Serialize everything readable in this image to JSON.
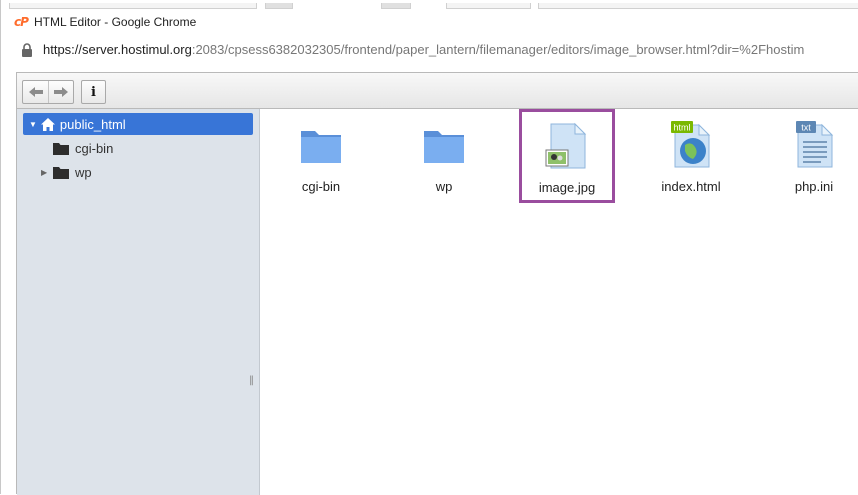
{
  "window": {
    "title": "HTML Editor - Google Chrome",
    "logo_text": "cP",
    "url_host": "https://server.hostimul.org",
    "url_rest": ":2083/cpsess6382032305/frontend/paper_lantern/filemanager/editors/image_browser.html?dir=%2Fhostim"
  },
  "toolbar": {
    "back_icon": "arrow-left-icon",
    "forward_icon": "arrow-right-icon",
    "info_label": "i"
  },
  "tree": {
    "root": {
      "label": "public_html",
      "icon": "home-icon"
    },
    "children": [
      {
        "label": "cgi-bin",
        "expandable": false
      },
      {
        "label": "wp",
        "expandable": true
      }
    ]
  },
  "files": [
    {
      "name": "cgi-bin",
      "type": "folder"
    },
    {
      "name": "wp",
      "type": "folder"
    },
    {
      "name": "image.jpg",
      "type": "image",
      "selected": true
    },
    {
      "name": "index.html",
      "type": "html",
      "badge": "html"
    },
    {
      "name": "php.ini",
      "type": "text",
      "badge": "txt"
    }
  ],
  "colors": {
    "selection": "#3875d7",
    "highlight_box": "#9a4d9e",
    "folder": "#6fa3e6"
  }
}
